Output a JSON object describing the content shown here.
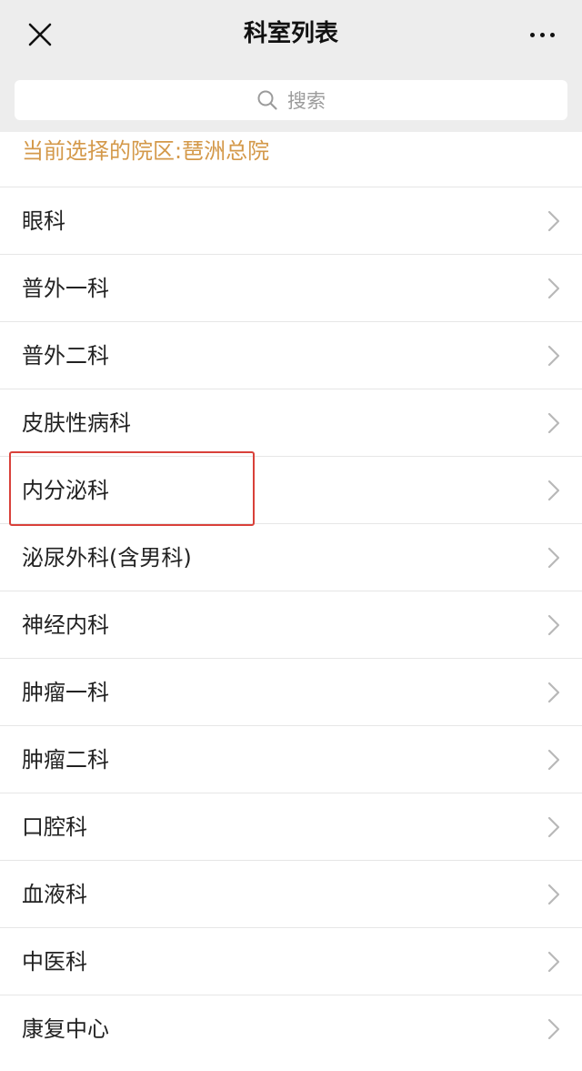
{
  "nav": {
    "title": "科室列表",
    "close_icon": "close-icon",
    "more_icon": "more-dots-icon"
  },
  "search": {
    "placeholder": "搜索",
    "icon": "search-icon"
  },
  "campus": {
    "text": "当前选择的院区:琶洲总院"
  },
  "departments": [
    {
      "label": "眼科"
    },
    {
      "label": "普外一科"
    },
    {
      "label": "普外二科"
    },
    {
      "label": "皮肤性病科"
    },
    {
      "label": "内分泌科"
    },
    {
      "label": "泌尿外科(含男科)"
    },
    {
      "label": "神经内科"
    },
    {
      "label": "肿瘤一科"
    },
    {
      "label": "肿瘤二科"
    },
    {
      "label": "口腔科"
    },
    {
      "label": "血液科"
    },
    {
      "label": "中医科"
    },
    {
      "label": "康复中心"
    }
  ],
  "colors": {
    "campus_text": "#d4994a",
    "highlight_border": "#d9413a",
    "nav_background": "#ededed"
  }
}
